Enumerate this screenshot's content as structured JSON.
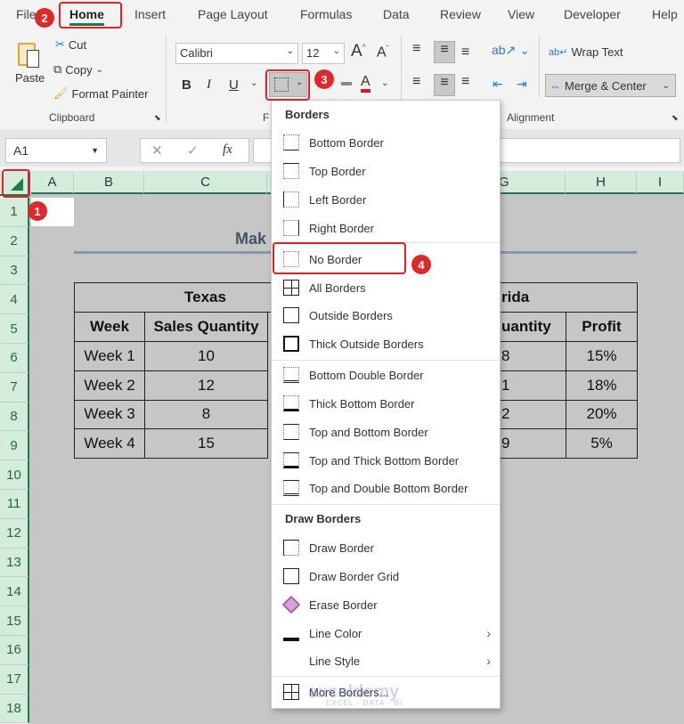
{
  "tabs": [
    "File",
    "Home",
    "Insert",
    "Page Layout",
    "Formulas",
    "Data",
    "Review",
    "View",
    "Developer",
    "Help"
  ],
  "ribbon": {
    "paste": "Paste",
    "cut": "Cut",
    "copy": "Copy",
    "format_painter": "Format Painter",
    "clipboard": "Clipboard",
    "font_name": "Calibri",
    "font_size": "12",
    "bold": "B",
    "italic": "I",
    "underline": "U",
    "font_group": "F",
    "font_color": "#e81123",
    "wrap_text": "Wrap Text",
    "merge_center": "Merge & Center",
    "alignment": "Alignment"
  },
  "formula_bar": {
    "name_box": "A1",
    "fx": "fx",
    "cancel": "✕",
    "enter": "✓"
  },
  "sheet": {
    "columns": [
      "A",
      "B",
      "C",
      "G",
      "H",
      "I"
    ],
    "rows": [
      "1",
      "2",
      "3",
      "4",
      "5",
      "6",
      "7",
      "8",
      "9",
      "10",
      "11",
      "12",
      "13",
      "14",
      "15",
      "16",
      "17",
      "18"
    ],
    "title_partial": "Mak",
    "texas": "Texas",
    "florida_partial": "rida",
    "headers": {
      "week": "Week",
      "sales_quantity": "Sales Quantity",
      "sales_quantity_partial": "uantity",
      "profit": "Profit"
    },
    "data": [
      {
        "week": "Week 1",
        "qty": "10",
        "g": "8",
        "profit": "15%"
      },
      {
        "week": "Week 2",
        "qty": "12",
        "g": "1",
        "profit": "18%"
      },
      {
        "week": "Week 3",
        "qty": "8",
        "g": "2",
        "profit": "20%"
      },
      {
        "week": "Week 4",
        "qty": "15",
        "g": "9",
        "profit": "5%"
      }
    ]
  },
  "menu": {
    "borders_heading": "Borders",
    "items": [
      "Bottom Border",
      "Top Border",
      "Left Border",
      "Right Border",
      "No Border",
      "All Borders",
      "Outside Borders",
      "Thick Outside Borders",
      "Bottom Double Border",
      "Thick Bottom Border",
      "Top and Bottom Border",
      "Top and Thick Bottom Border",
      "Top and Double Bottom Border"
    ],
    "draw_heading": "Draw Borders",
    "draw_items": [
      "Draw Border",
      "Draw Border Grid",
      "Erase Border",
      "Line Color",
      "Line Style",
      "More Borders..."
    ]
  },
  "badges": [
    "1",
    "2",
    "3",
    "4"
  ],
  "watermark": {
    "name": "exceldemy",
    "tagline": "EXCEL · DATA · BI"
  },
  "colors": {
    "accent_green": "#1f7a45",
    "highlight_red": "#e32027",
    "title_blue": "#44546a"
  }
}
